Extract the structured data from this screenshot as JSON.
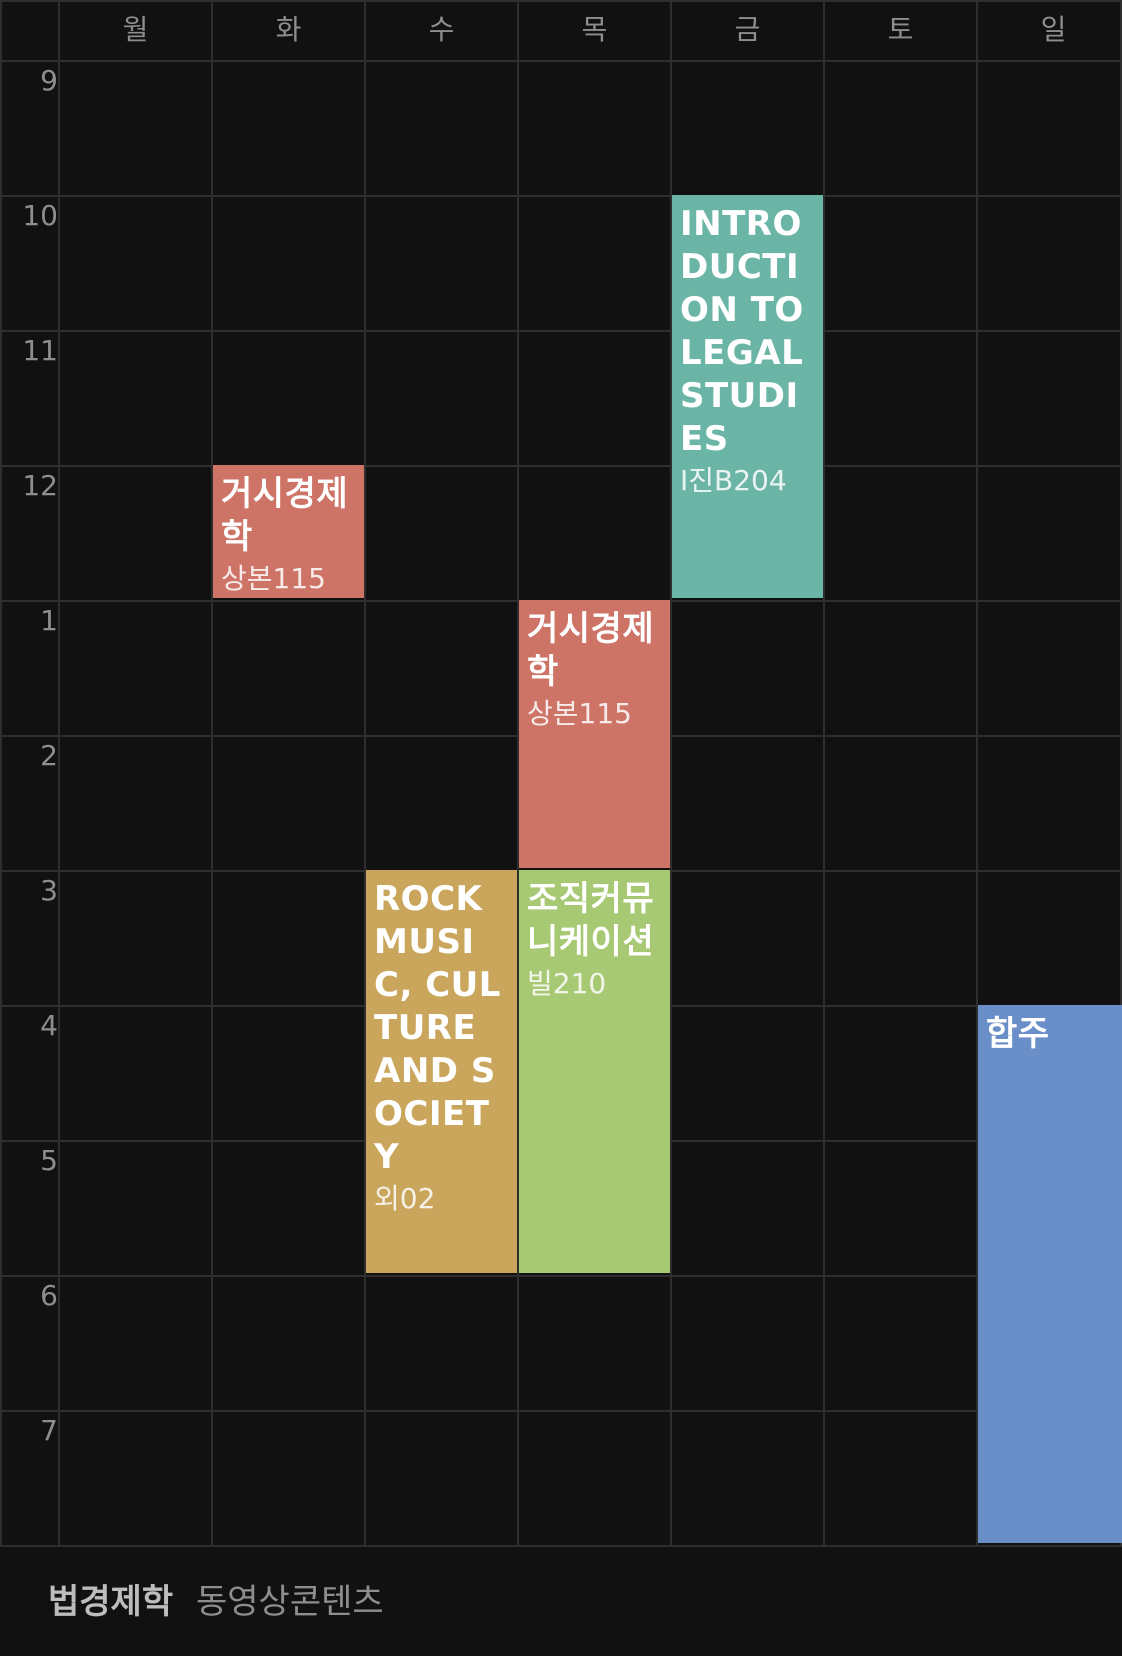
{
  "days": [
    "월",
    "화",
    "수",
    "목",
    "금",
    "토",
    "일"
  ],
  "hours": [
    "9",
    "10",
    "11",
    "12",
    "1",
    "2",
    "3",
    "4",
    "5",
    "6",
    "7"
  ],
  "events": [
    {
      "id": "ev-macro-tue",
      "title": "거시경제학",
      "room": "상본115",
      "day": 1,
      "start": 12,
      "end": 13,
      "color": "#cd7467"
    },
    {
      "id": "ev-legal-fri",
      "title": "INTRODUCTION TO LEGAL STUDIES",
      "room": "I진B204",
      "day": 4,
      "start": 10,
      "end": 13,
      "color": "#6bb5a6"
    },
    {
      "id": "ev-macro-thu",
      "title": "거시경제학",
      "room": "상본115",
      "day": 3,
      "start": 13,
      "end": 15,
      "color": "#cd7467"
    },
    {
      "id": "ev-rock-wed",
      "title": "ROCK MUSIC, CULTURE AND SOCIETY",
      "room": "외02",
      "day": 2,
      "start": 15,
      "end": 18,
      "color": "#c9a65b"
    },
    {
      "id": "ev-orgcomm-thu",
      "title": "조직커뮤니케이션",
      "room": "빌210",
      "day": 3,
      "start": 15,
      "end": 18,
      "color": "#a8c974"
    },
    {
      "id": "ev-ensemble-sun",
      "title": "합주",
      "room": "",
      "day": 6,
      "start": 16,
      "end": 20,
      "color": "#6a8ec8"
    }
  ],
  "footer": {
    "items": [
      {
        "label": "법경제학",
        "color": "#bdbdbd"
      },
      {
        "label": "동영상콘텐츠",
        "color": "#8e8e8e"
      }
    ]
  }
}
